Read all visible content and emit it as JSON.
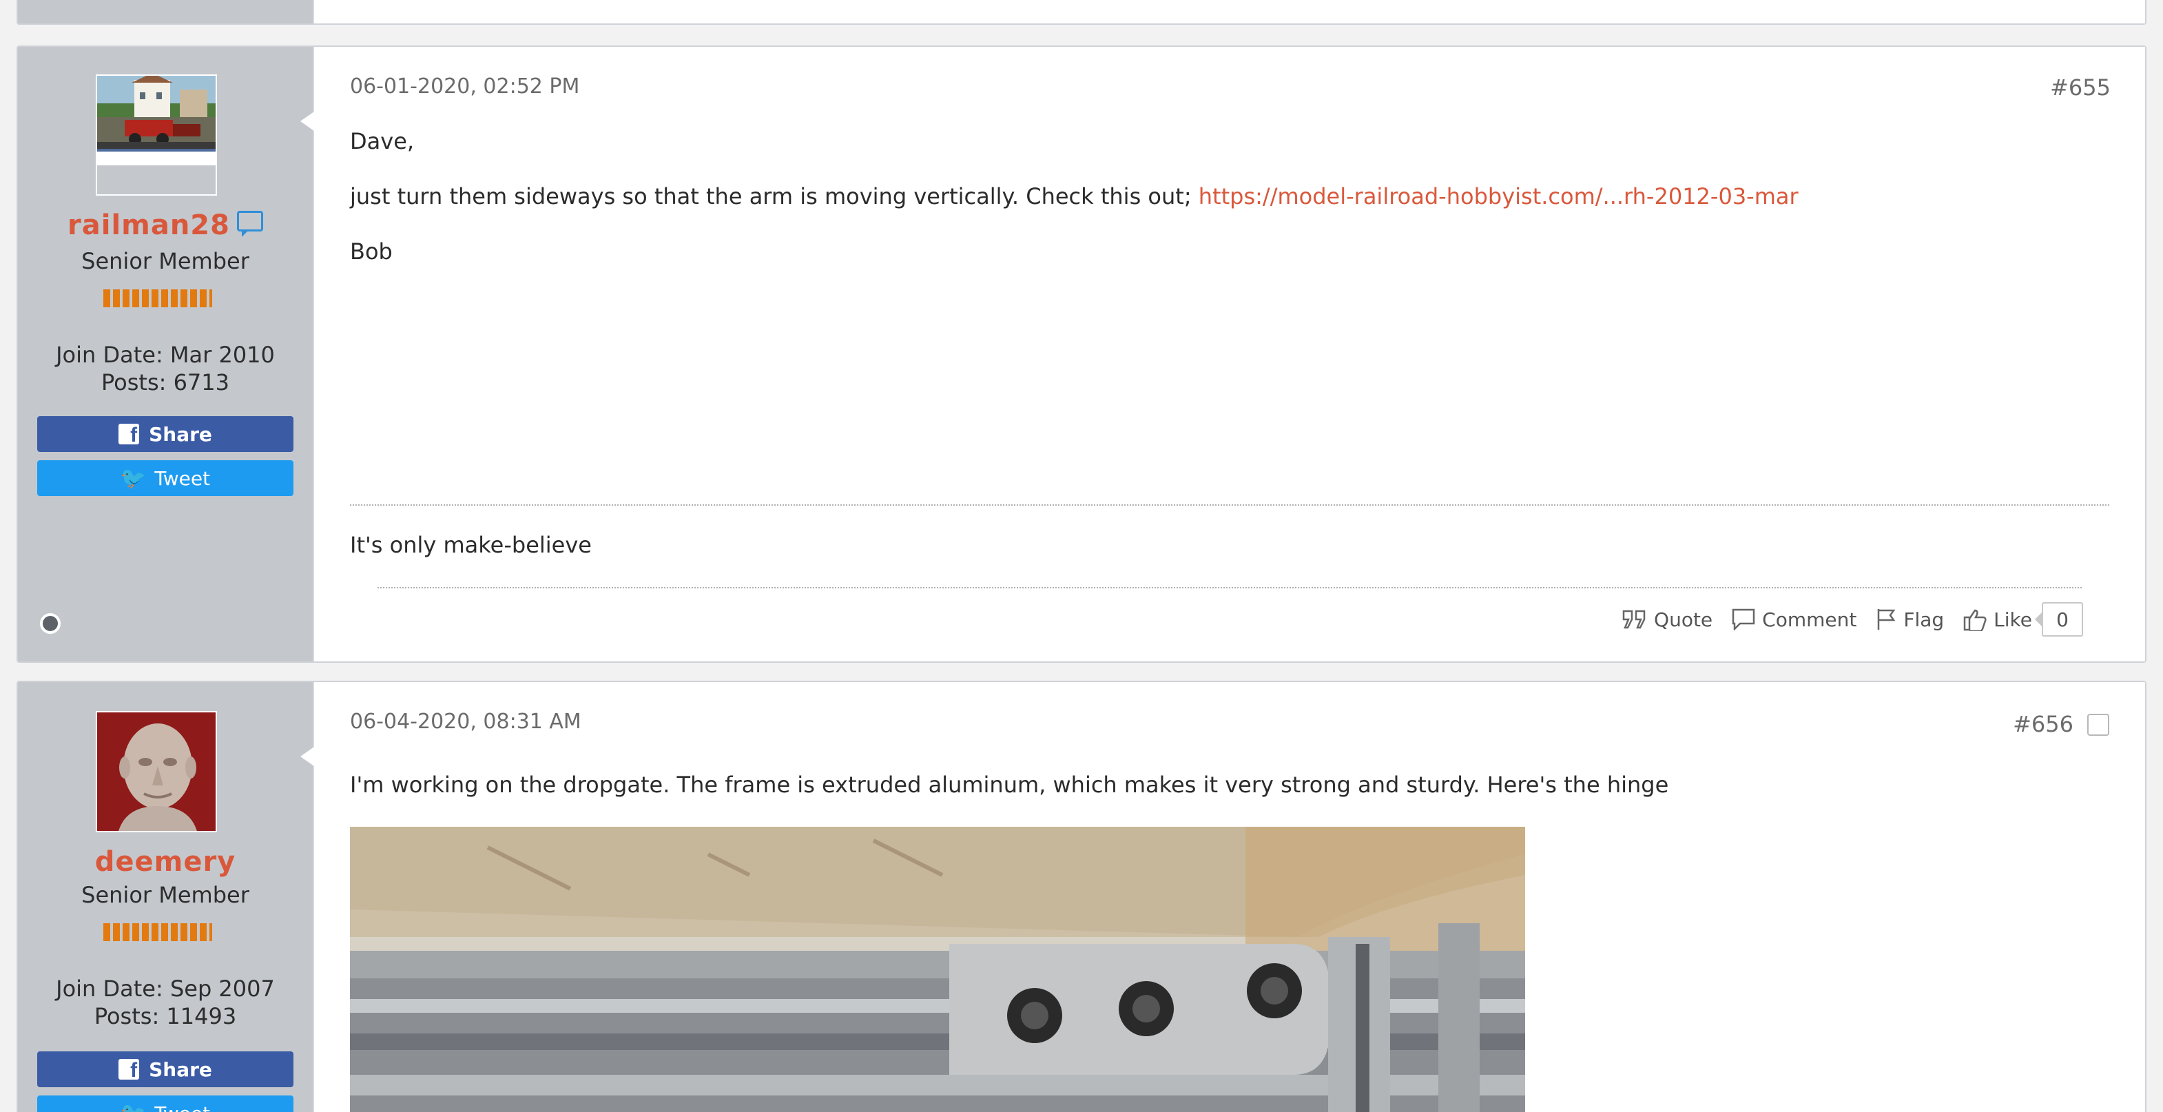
{
  "posts": [
    {
      "date": "06-01-2020, 02:52 PM",
      "number": "#655",
      "user": {
        "name": "railman28",
        "title": "Senior Member",
        "join_date": "Join Date: Mar 2010",
        "posts": "Posts: 6713"
      },
      "content": {
        "greeting": "Dave,",
        "text": "just turn them sideways so that the arm is moving vertically. Check this out; ",
        "link": "https://model-railroad-hobbyist.com/...rh-2012-03-mar",
        "signoff": "Bob"
      },
      "signature": "It's only make-believe",
      "actions": {
        "quote": "Quote",
        "comment": "Comment",
        "flag": "Flag",
        "like": "Like",
        "like_count": "0"
      }
    },
    {
      "date": "06-04-2020, 08:31 AM",
      "number": "#656",
      "user": {
        "name": "deemery",
        "title": "Senior Member",
        "join_date": "Join Date: Sep 2007",
        "posts": "Posts: 11493"
      },
      "content": {
        "text": "I'm working on the dropgate. The frame is extruded aluminum, which makes it very strong and sturdy. Here's the hinge"
      }
    }
  ],
  "buttons": {
    "share": "Share",
    "tweet": "Tweet"
  },
  "icons": {
    "pm": "speech-bubble-icon",
    "status": "offline-status-icon",
    "quote": "quote-icon",
    "comment": "comment-icon",
    "flag": "flag-icon",
    "like": "thumbs-up-icon",
    "facebook": "facebook-icon",
    "twitter": "twitter-icon"
  },
  "colors": {
    "username": "#d9583b",
    "link": "#d9583b",
    "facebook": "#3b5ba5",
    "twitter": "#1d9bf0",
    "reputation": "#e27a10",
    "userinfo_bg": "#c4c8cd"
  }
}
